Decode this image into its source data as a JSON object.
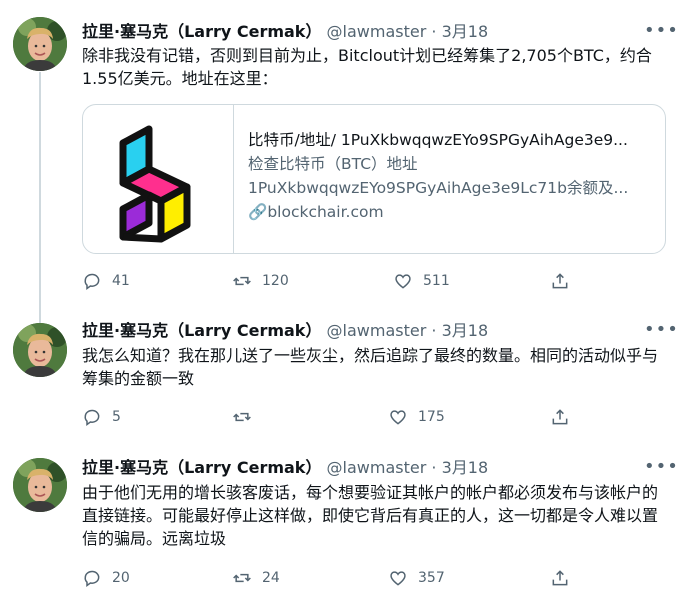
{
  "tweets": [
    {
      "author_name": "拉里·塞马克（Larry Cermak）",
      "handle": "@lawmaster",
      "date": "3月18",
      "separator": "·",
      "text": "除非我没有记错，否则到目前为止，Bitclout计划已经筹集了2,705个BTC，约合1.55亿美元。地址在这里：",
      "card": {
        "title": "比特币/地址/ 1PuXkbwqqwzEYo9SPGyAihAge3e9...",
        "description_line1": "检查比特币（BTC）地址",
        "description_line2": "1PuXkbwqqwzEYo9SPGyAihAge3e9Lc71b余额及...",
        "domain": "blockchair.com"
      },
      "replies": "41",
      "retweets": "120",
      "likes": "511"
    },
    {
      "author_name": "拉里·塞马克（Larry Cermak）",
      "handle": "@lawmaster",
      "date": "3月18",
      "separator": "·",
      "text": "我怎么知道？我在那儿送了一些灰尘，然后追踪了最终的数量。相同的活动似乎与筹集的金额一致",
      "replies": "5",
      "retweets": "",
      "likes": "175"
    },
    {
      "author_name": "拉里·塞马克（Larry Cermak）",
      "handle": "@lawmaster",
      "date": "3月18",
      "separator": "·",
      "text": "由于他们无用的增长骇客废话，每个想要验证其帐户的帐户都必须发布与该帐户的直接链接。可能最好停止这样做，即使它背后有真正的人，这一切都是令人难以置信的骗局。远离垃圾",
      "replies": "20",
      "retweets": "24",
      "likes": "357"
    }
  ],
  "icons": {
    "more": "more-dots-icon",
    "reply": "reply-icon",
    "retweet": "retweet-icon",
    "like": "heart-icon",
    "share": "share-icon",
    "link": "link-icon"
  },
  "colors": {
    "text": "#0f1419",
    "secondary": "#536471",
    "border": "#cfd9de",
    "logo_cyan": "#29d0f0",
    "logo_magenta": "#ff2f8e",
    "logo_yellow": "#ffee00",
    "logo_purple": "#9b2bd8"
  }
}
